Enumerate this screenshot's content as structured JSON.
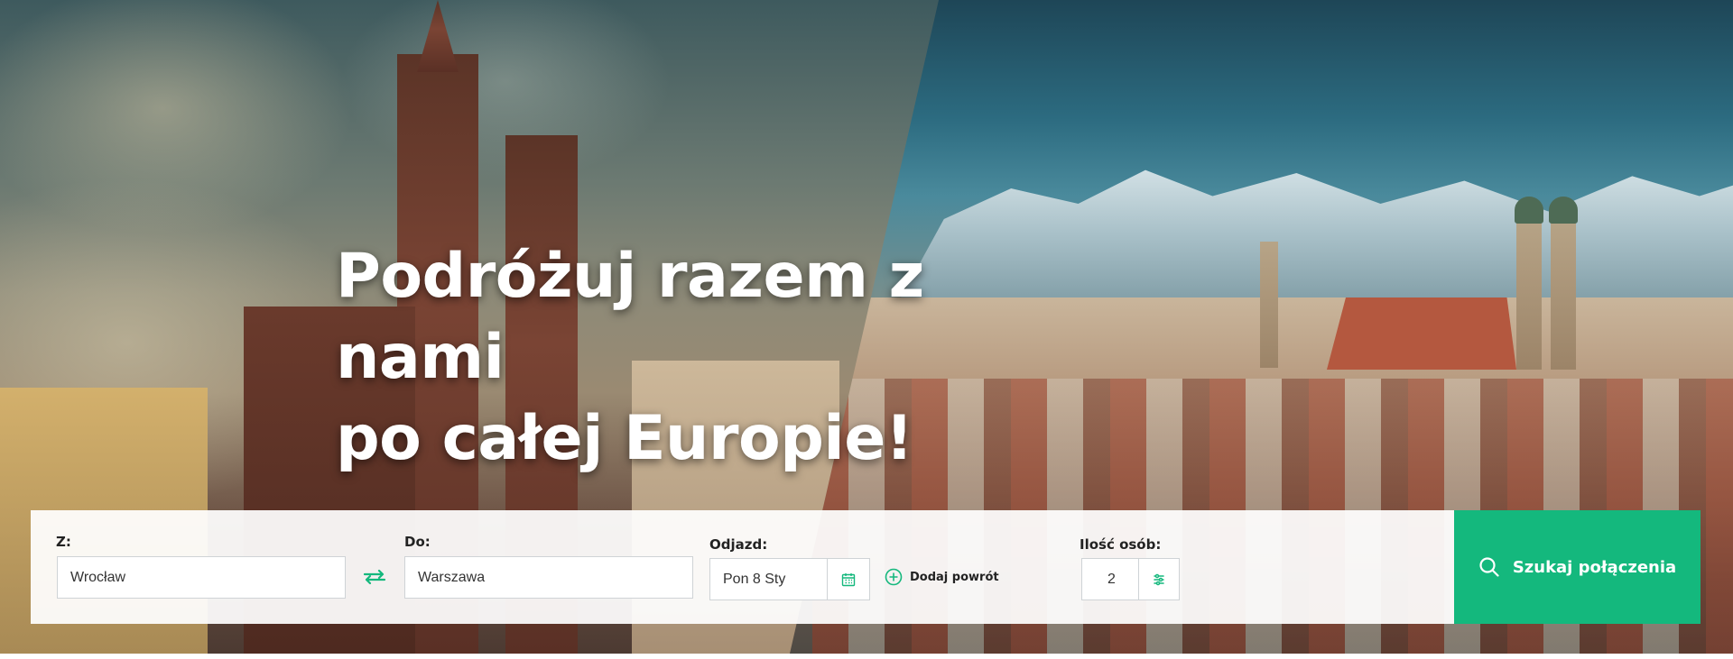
{
  "hero": {
    "title_line1": "Podróżuj razem z nami",
    "title_line2": "po całej Europie!"
  },
  "search": {
    "from_label": "Z:",
    "from_value": "Wrocław",
    "to_label": "Do:",
    "to_value": "Warszawa",
    "departure_label": "Odjazd:",
    "departure_value": "Pon 8 Sty",
    "add_return_label": "Dodaj powrót",
    "persons_label": "Ilość osób:",
    "persons_value": "2",
    "submit_label": "Szukaj połączenia"
  },
  "icons": {
    "swap": "swap-arrows-icon",
    "calendar": "calendar-icon",
    "add": "plus-circle-icon",
    "persons": "sliders-icon",
    "search": "search-icon"
  },
  "colors": {
    "accent": "#14b87d",
    "title": "#ffffff"
  }
}
